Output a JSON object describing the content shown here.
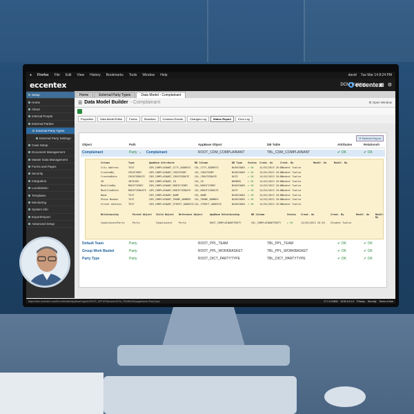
{
  "macbar": {
    "apple": "",
    "app": "Firefox",
    "menus": [
      "File",
      "Edit",
      "View",
      "History",
      "Bookmarks",
      "Tools",
      "Window",
      "Help"
    ],
    "user": "david",
    "datetime": "Tue Mar 14  8:24 PM"
  },
  "appbar": {
    "logo": "eccentex",
    "training": "DCM Training"
  },
  "overlay_logo": "eccentex",
  "sidebar": {
    "items": [
      {
        "label": "Setup",
        "kind": "header"
      },
      {
        "label": "Home",
        "kind": "item"
      },
      {
        "label": "About",
        "kind": "item"
      },
      {
        "label": "Internal People",
        "kind": "item"
      },
      {
        "label": "External Parties",
        "kind": "item"
      },
      {
        "label": "External Party Types",
        "kind": "active"
      },
      {
        "label": "External Party Settings",
        "kind": "subsub"
      },
      {
        "label": "Case Setup",
        "kind": "item"
      },
      {
        "label": "Document Management",
        "kind": "item"
      },
      {
        "label": "Master Data Management",
        "kind": "item"
      },
      {
        "label": "Forms and Pages",
        "kind": "item"
      },
      {
        "label": "Security",
        "kind": "item"
      },
      {
        "label": "Integration",
        "kind": "item"
      },
      {
        "label": "Localization",
        "kind": "item"
      },
      {
        "label": "Templates",
        "kind": "item"
      },
      {
        "label": "Monitoring",
        "kind": "item"
      },
      {
        "label": "System Info",
        "kind": "item"
      },
      {
        "label": "Export/Import",
        "kind": "item"
      },
      {
        "label": "Advanced Setup",
        "kind": "item"
      }
    ]
  },
  "tabs": [
    {
      "label": "Home"
    },
    {
      "label": "External Party Types"
    },
    {
      "label": "Data Model - Complainant"
    }
  ],
  "title": {
    "main": "Data Model Builder",
    "sub": "- Complainant",
    "open_window": "Open Window"
  },
  "subtabs": [
    "Properties",
    "Data Model Editor",
    "Forms",
    "Searches",
    "Common Events",
    "Changes Log",
    "Status Report",
    "Error Log"
  ],
  "refresh": "Refresh Report",
  "grid": {
    "headers": [
      "Object",
      "Path",
      "AppBase Object",
      "DB Table",
      "Attributes",
      "Relationsh"
    ],
    "rows": [
      {
        "object": "Complainant",
        "path_from": "Party",
        "arrow": "→",
        "path_to": "Complainant",
        "appbase": "ROOT_CDM_COMPLAINANT",
        "table": "TBL_CDM_COMPLAINANT",
        "attr": "✔ OK",
        "rel": "✔ OK"
      },
      {
        "object": "Default Team",
        "path_from": "Party",
        "arrow": "",
        "path_to": "",
        "appbase": "ROOT_PPL_TEAM",
        "table": "TBL_PPL_TEAM",
        "attr": "✔ OK",
        "rel": "✔ OK"
      },
      {
        "object": "Group Work Basket",
        "path_from": "Party",
        "arrow": "",
        "path_to": "",
        "appbase": "ROOT_PPL_WORKBASKET",
        "table": "TBL_PPL_WORKBASKET",
        "attr": "✔ OK",
        "rel": "✔ OK"
      },
      {
        "object": "Party Type",
        "path_from": "Party",
        "arrow": "",
        "path_to": "",
        "appbase": "ROOT_DICT_PARTYTYPE",
        "table": "TBL_DICT_PARTYTYPE",
        "attr": "✔ OK",
        "rel": "✔ OK"
      }
    ]
  },
  "detail": {
    "headers": [
      "Column",
      "Type",
      "AppBase Attribute",
      "DB Column",
      "DB Type",
      "Status",
      "Creat. On",
      "Creat. By",
      "Modif. On",
      "Modif. By"
    ],
    "rows": [
      [
        "City Address",
        "TEXT",
        "CDM_COMPLAINANT_CITY_ADDRESS",
        "COL_CITY_ADDRESS",
        "NVARCHAR2",
        "✔ OK",
        "14/03/2023 20:10",
        "Student Twelve"
      ],
      [
        "CreatedBy",
        "CREATEDBY",
        "CDM_COMPLAINANT_CREATEDBY",
        "COL_CREATEDBY",
        "NVARCHAR2",
        "✔ OK",
        "14/03/2023 20:10",
        "Student Twelve"
      ],
      [
        "CreatedDate",
        "CREATEDDATE",
        "CDM_COMPLAINANT_CREATEDDATE",
        "COL_CREATEDDATE",
        "DATE",
        "✔ OK",
        "14/03/2023 20:10",
        "Student Twelve"
      ],
      [
        "ID",
        "INTEGER",
        "CDM_COMPLAINANT_ID",
        "COL_ID",
        "NUMBER",
        "✔ OK",
        "14/03/2023 20:10",
        "Student Twelve"
      ],
      [
        "ModifiedBy",
        "MODIFIEDBY",
        "CDM_COMPLAINANT_MODIFIEDBY",
        "COL_MODIFIEDBY",
        "NVARCHAR2",
        "✔ OK",
        "14/03/2023 20:10",
        "Student Twelve"
      ],
      [
        "ModifiedDate",
        "MODIFIEDDATE",
        "CDM_COMPLAINANT_MODIFIEDDATE",
        "COL_MODIFIEDDATE",
        "DATE",
        "✔ OK",
        "14/03/2023 20:10",
        "Student Twelve"
      ],
      [
        "Name",
        "TEXT",
        "CDM_COMPLAINANT_NAME",
        "COL_NAME",
        "NVARCHAR2",
        "✔ OK",
        "14/03/2023 20:10",
        "Student Twelve"
      ],
      [
        "Phone Number",
        "TEXT",
        "CDM_COMPLAINANT_PHONE_NUMBER",
        "COL_PHONE_NUMBER",
        "NVARCHAR2",
        "✔ OK",
        "14/03/2023 20:10",
        "Student Twelve"
      ],
      [
        "Street Address",
        "TEXT",
        "CDM_COMPLAINANT_STREET_ADDRESS",
        "COL_STREET_ADDRESS",
        "NVARCHAR2",
        "✔ OK",
        "14/03/2023 20:10",
        "Student Twelve"
      ]
    ],
    "rel_headers": [
      "Relationship",
      "Parent Object",
      "Child Object",
      "Reference Object",
      "AppBase Relationship",
      "DB Column",
      "Status",
      "Creat. On",
      "Creat. By",
      "Modif. On",
      "Modif. By"
    ],
    "rel_row": [
      "ComplainantParty",
      "Party",
      "Complainant",
      "Party",
      "ROOT_COMPLAINANTPARTY",
      "COL_COMPLAINANTPARTY",
      "✔ OK",
      "14/03/2023 20:10",
      "Student Twelve"
    ]
  },
  "statusbar": {
    "url": "https://dcm.eccentex.com/Ecx.Web/abc/AppBase?appid=ROOT_SETUP&tenant=DCM_TRAINING&pageName=PartyType",
    "version": "17.1.0.24605",
    "dcm": "DCM 3.6.1.0",
    "links": [
      "Privacy",
      "Security",
      "Terms of Use"
    ]
  }
}
